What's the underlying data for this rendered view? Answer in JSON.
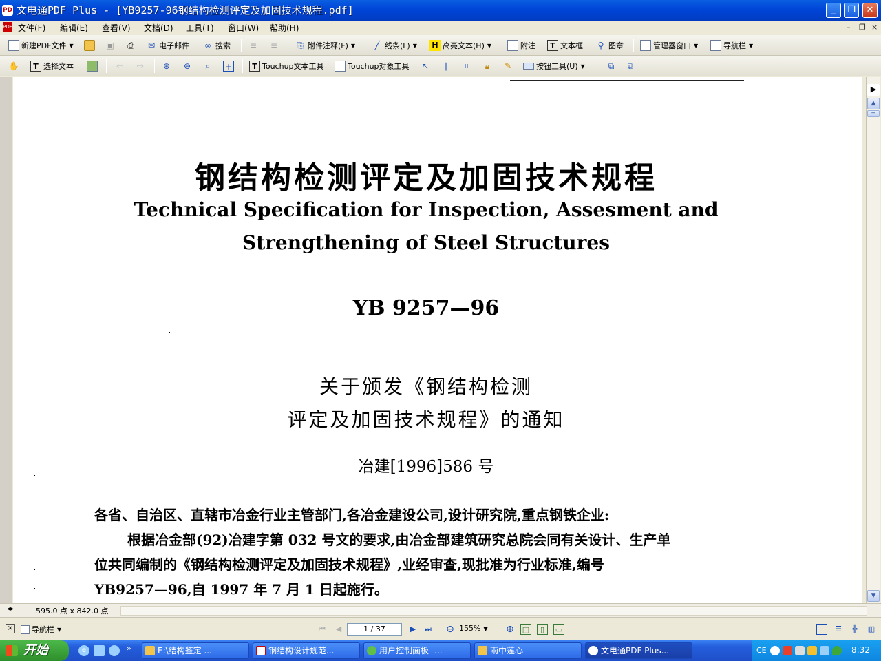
{
  "window": {
    "title": "文电通PDF Plus - [YB9257-96钢结构检测评定及加固技术规程.pdf]",
    "app_icon": "pdf-app-icon"
  },
  "menu": [
    {
      "label": "文件(F)"
    },
    {
      "label": "编辑(E)"
    },
    {
      "label": "查看(V)"
    },
    {
      "label": "文档(D)"
    },
    {
      "label": "工具(T)"
    },
    {
      "label": "窗口(W)"
    },
    {
      "label": "帮助(H)"
    }
  ],
  "toolbar1": {
    "new_pdf": "新建PDF文件",
    "email": "电子邮件",
    "search": "搜索",
    "attach_annot": "附件注释(F)",
    "line": "线条(L)",
    "highlight": "高亮文本(H)",
    "note": "附注",
    "textbox": "文本框",
    "stamp": "图章",
    "manager": "管理器窗口",
    "navpanel": "导航栏"
  },
  "toolbar2": {
    "select_text": "选择文本",
    "touchup_text": "Touchup文本工具",
    "touchup_object": "Touchup对象工具",
    "button_tool": "按钮工具(U)"
  },
  "document": {
    "title_cn": "钢结构检测评定及加固技术规程",
    "title_en_1": "Technical Specification for Inspection, Assesment and",
    "title_en_2": "Strengthening of Steel Structures",
    "standard_code": "YB 9257—96",
    "notice_1": "关于颁发《钢结构检测",
    "notice_2": "评定及加固技术规程》的通知",
    "doc_number": "冶建[1996]586 号",
    "body_line_1": "各省、自治区、直辖市冶金行业主管部门,各冶金建设公司,设计研究院,重点钢铁企业:",
    "body_line_2": "根据冶金部(92)冶建字第 032 号文的要求,由冶金部建筑研究总院会同有关设计、生产单",
    "body_line_3": "位共同编制的《钢结构检测评定及加固技术规程》,业经审查,现批准为行业标准,编号",
    "body_line_4": "YB9257—96,自 1997 年 7 月 1 日起施行。"
  },
  "status": {
    "page_size": "595.0 点 x 842.0 点"
  },
  "navbar": {
    "nav_panel": "导航栏",
    "page_value": "1 / 37",
    "zoom_value": "155%"
  },
  "taskbar": {
    "start": "开始",
    "tasks": [
      {
        "label": "E:\\结构鉴定  ..."
      },
      {
        "label": "钢结构设计规范..."
      },
      {
        "label": "用户控制面板 -..."
      },
      {
        "label": "雨中莲心"
      },
      {
        "label": "文电通PDF Plus..."
      }
    ],
    "lang": "CE",
    "clock": "8:32"
  }
}
